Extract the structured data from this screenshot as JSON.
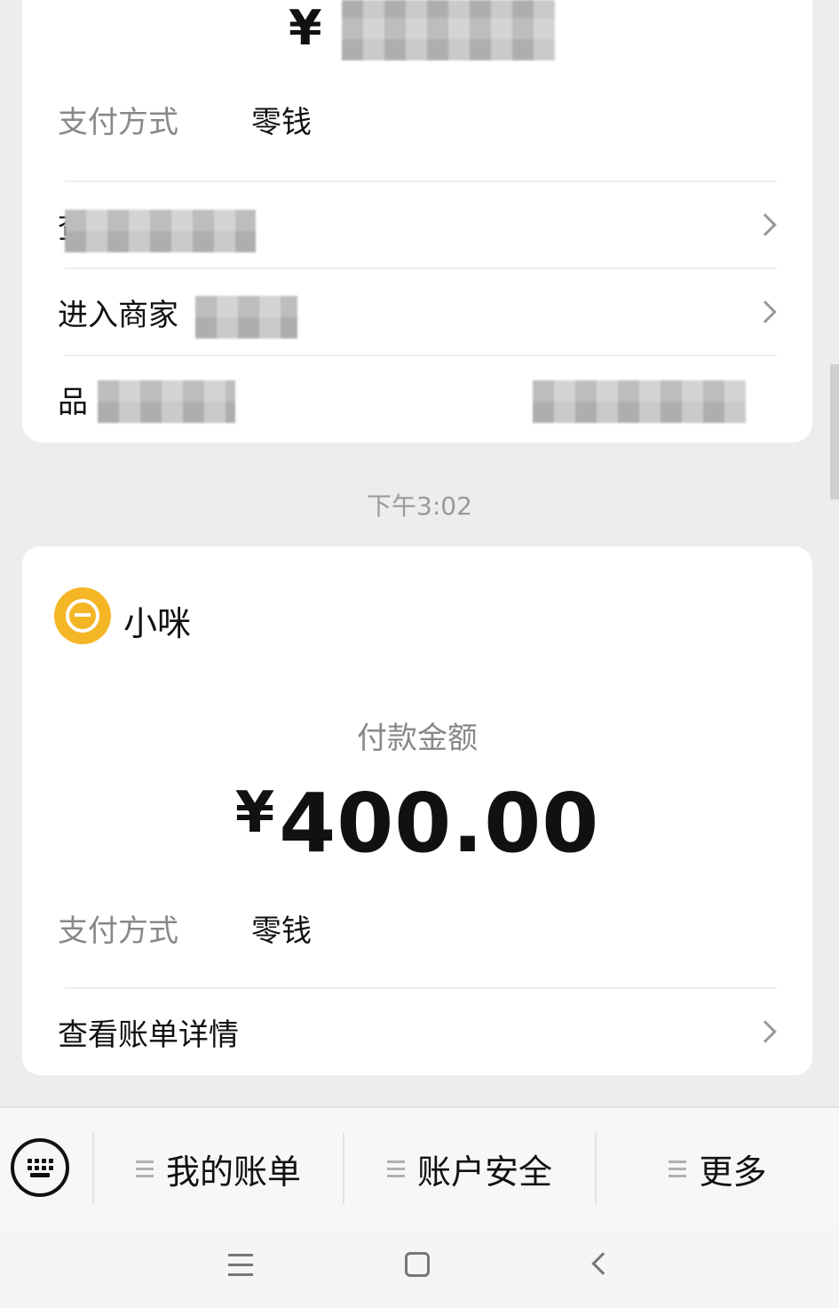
{
  "top_card": {
    "amount_prefix": "¥",
    "payment_method_label": "支付方式",
    "payment_method_value": "零钱",
    "row_bill_details": "查",
    "row_enter_merchant": "进入商家",
    "row_brand": "品"
  },
  "timestamp": "下午3:02",
  "main_card": {
    "merchant_name": "小咪",
    "pay_amount_label": "付款金额",
    "amount_currency": "¥",
    "amount_value": "400.00",
    "payment_method_label": "支付方式",
    "payment_method_value": "零钱",
    "view_bill_details": "查看账单详情"
  },
  "menu_bar": {
    "items": [
      {
        "label": "我的账单"
      },
      {
        "label": "账户安全"
      },
      {
        "label": "更多"
      }
    ]
  },
  "icons": {
    "keyboard": "keyboard-icon",
    "chevron": "chevron-right-icon",
    "menu_lines": "menu-lines-icon",
    "nav_menu": "nav-menu-icon",
    "nav_home": "nav-home-icon",
    "nav_back": "nav-back-icon",
    "merchant_logo": "merchant-logo-icon"
  },
  "colors": {
    "background": "#ededed",
    "card": "#ffffff",
    "merchant_logo": "#f5b626",
    "secondary_text": "#888888"
  }
}
